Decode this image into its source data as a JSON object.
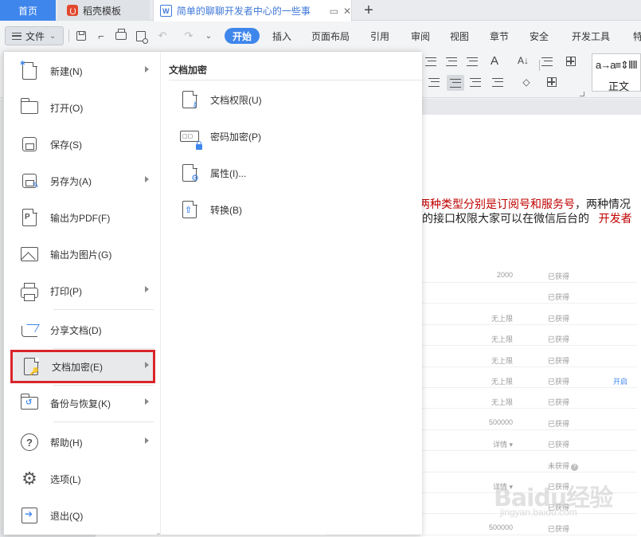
{
  "tabs": {
    "home": "首页",
    "template": "稻壳模板",
    "document": "简单的聊聊开发者中心的一些事"
  },
  "toolbar": {
    "file_label": "文件",
    "ribbon_tabs": [
      "开始",
      "插入",
      "页面布局",
      "引用",
      "审阅",
      "视图",
      "章节",
      "安全",
      "开发工具",
      "特"
    ],
    "style_sample": "a→a≡⇕ⅡⅡ",
    "style_name": "正文"
  },
  "file_menu": {
    "items": [
      {
        "label": "新建(N)",
        "icon": "new-document-icon",
        "has_submenu": true
      },
      {
        "label": "打开(O)",
        "icon": "folder-open-icon",
        "has_submenu": false
      },
      {
        "label": "保存(S)",
        "icon": "save-disk-icon",
        "has_submenu": false
      },
      {
        "label": "另存为(A)",
        "icon": "save-as-icon",
        "has_submenu": true
      },
      {
        "label": "输出为PDF(F)",
        "icon": "export-pdf-icon",
        "has_submenu": false
      },
      {
        "label": "输出为图片(G)",
        "icon": "export-image-icon",
        "has_submenu": false
      },
      {
        "label": "打印(P)",
        "icon": "printer-icon",
        "has_submenu": true
      },
      {
        "label": "分享文档(D)",
        "icon": "share-icon",
        "has_submenu": false
      },
      {
        "label": "文档加密(E)",
        "icon": "document-encrypt-icon",
        "has_submenu": true,
        "selected": true
      },
      {
        "label": "备份与恢复(K)",
        "icon": "backup-restore-icon",
        "has_submenu": true
      },
      {
        "label": "帮助(H)",
        "icon": "help-icon",
        "has_submenu": true
      },
      {
        "label": "选项(L)",
        "icon": "gear-icon",
        "has_submenu": false
      },
      {
        "label": "退出(Q)",
        "icon": "exit-icon",
        "has_submenu": false
      }
    ]
  },
  "submenu": {
    "title": "文档加密",
    "items": [
      {
        "label": "文档权限(U)",
        "icon": "document-permission-icon"
      },
      {
        "label": "密码加密(P)",
        "icon": "password-encrypt-icon"
      },
      {
        "label": "属性(I)...",
        "icon": "properties-icon"
      },
      {
        "label": "转换(B)",
        "icon": "convert-icon"
      }
    ]
  },
  "document": {
    "line1_red": "两种类型分别是订阅号和服务号",
    "line1_black": "，两种情况",
    "line2_black": "的接口权限大家可以在微信后台的",
    "line2_red": "开发者",
    "table": [
      {
        "value": "2000",
        "status": "已获得",
        "extra": ""
      },
      {
        "value": "",
        "status": "已获得",
        "extra": ""
      },
      {
        "value": "无上限",
        "status": "已获得",
        "extra": ""
      },
      {
        "value": "无上限",
        "status": "已获得",
        "extra": ""
      },
      {
        "value": "无上限",
        "status": "已获得",
        "extra": ""
      },
      {
        "value": "无上限",
        "status": "已获得",
        "extra": "开启"
      },
      {
        "value": "无上限",
        "status": "已获得",
        "extra": ""
      },
      {
        "value": "500000",
        "status": "已获得",
        "extra": ""
      },
      {
        "value": "详情 ▾",
        "status": "已获得",
        "extra": ""
      },
      {
        "value": "",
        "status": "未获得",
        "extra": ""
      },
      {
        "value": "详情 ▾",
        "status": "已获得",
        "extra": ""
      },
      {
        "value": "",
        "status": "已获得",
        "extra": ""
      },
      {
        "value": "500000",
        "status": "已获得",
        "extra": ""
      }
    ],
    "watermark": "Baidu经验",
    "watermark_sub": "jingyan.baidu.com"
  }
}
